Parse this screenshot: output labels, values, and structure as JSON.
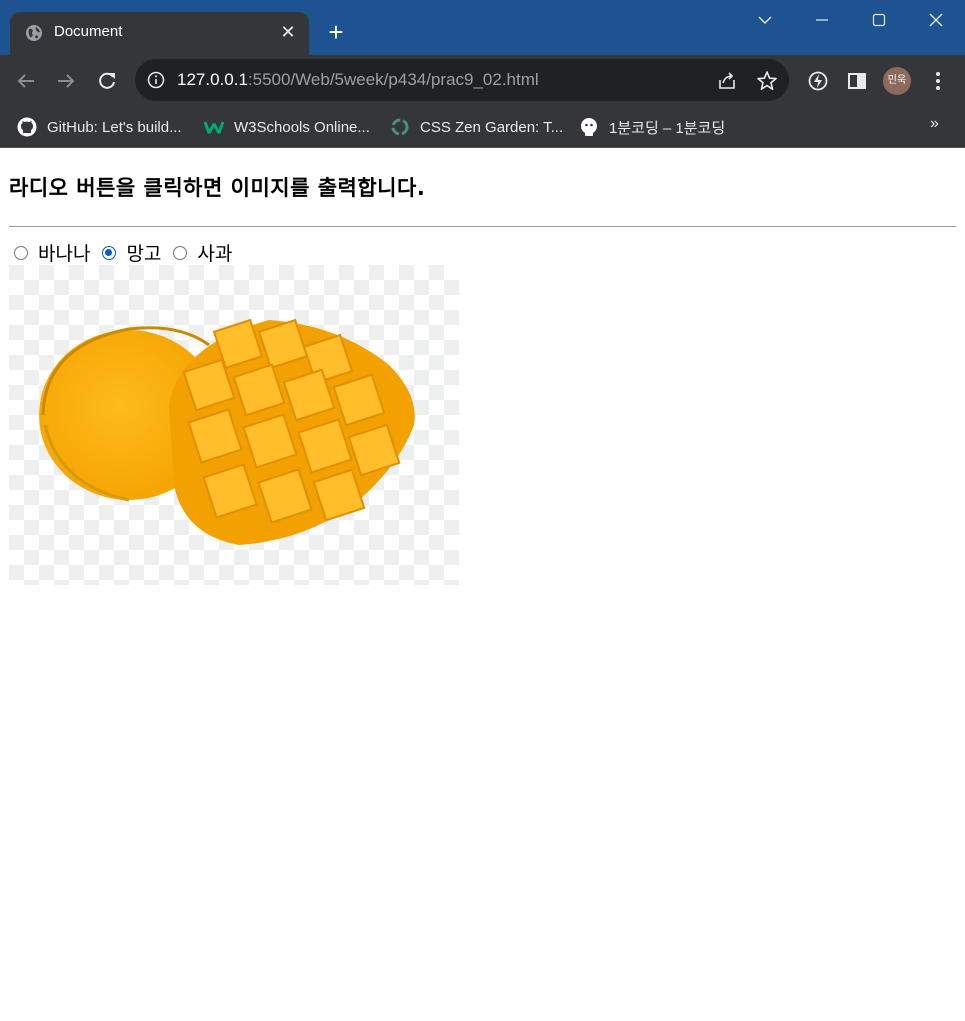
{
  "browser": {
    "tab_title": "Document",
    "url_host": "127.0.0.1",
    "url_rest": ":5500/Web/5week/p434/prac9_02.html",
    "profile_initials": "민욱",
    "titlebar_color": "#1d5391",
    "bookmarks": [
      {
        "label": "GitHub: Let's build...",
        "icon": "github-icon"
      },
      {
        "label": "W3Schools Online...",
        "icon": "w3schools-icon"
      },
      {
        "label": "CSS Zen Garden: T...",
        "icon": "zen-garden-icon"
      },
      {
        "label": "1분코딩 – 1분코딩",
        "icon": "1bun-coding-icon"
      }
    ],
    "bookmarks_more": "»"
  },
  "page": {
    "heading": "라디오 버튼을 클릭하면 이미지를 출력합니다.",
    "radios": [
      {
        "label": "바나나",
        "checked": false
      },
      {
        "label": "망고",
        "checked": true
      },
      {
        "label": "사과",
        "checked": false
      }
    ],
    "accent_color": "#0b57d0",
    "image": {
      "subject": "mango",
      "icon": "mango-image"
    }
  }
}
